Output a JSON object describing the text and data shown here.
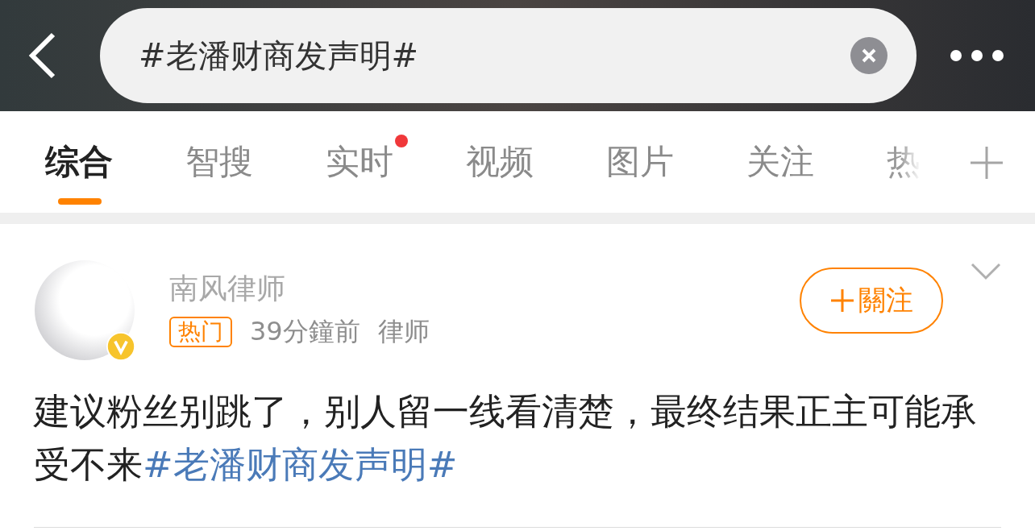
{
  "search": {
    "value": "#老潘财商发声明#"
  },
  "tabs": [
    {
      "label": "综合",
      "selected": true,
      "dot": false
    },
    {
      "label": "智搜",
      "selected": false,
      "dot": false
    },
    {
      "label": "实时",
      "selected": false,
      "dot": true
    },
    {
      "label": "视频",
      "selected": false,
      "dot": false
    },
    {
      "label": "图片",
      "selected": false,
      "dot": false
    },
    {
      "label": "关注",
      "selected": false,
      "dot": false
    },
    {
      "label": "热",
      "selected": false,
      "dot": false
    }
  ],
  "post": {
    "author": "南风律师",
    "verified": true,
    "badge": "热门",
    "time": "39分鐘前",
    "source": "律师",
    "follow_button": "關注",
    "text": "建议粉丝别跳了，别人留一线看清楚，最终结果正主可能承受不来",
    "hashtag": "#老潘财商发声明#"
  }
}
